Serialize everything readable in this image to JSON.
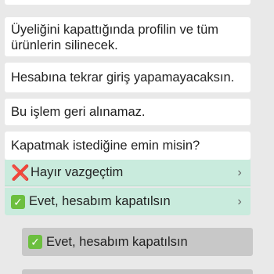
{
  "chat": {
    "bot_messages": [
      "Üyeliğini kapattığında profilin ve tüm ürünlerin silinecek.",
      "Hesabına tekrar giriş yapamayacaksın.",
      "Bu işlem geri alınamaz.",
      "Kapatmak istediğine emin misin?"
    ],
    "quick_replies": [
      {
        "icon": "cross-mark-icon",
        "label": "Hayır vazgeçtim"
      },
      {
        "icon": "check-mark-icon",
        "label": "Evet, hesabım kapatılsın"
      }
    ],
    "user_message": {
      "icon": "check-mark-icon",
      "label": "Evet, hesabım kapatılsın"
    }
  },
  "glyphs": {
    "cross": "❌",
    "check": "✓",
    "chevron": "›"
  },
  "colors": {
    "background": "#e9e9e9",
    "bot_bubble": "#ffffff",
    "quick_reply": "#c9ebdd",
    "user_bubble": "#c8c8c8",
    "cross": "#e0312b",
    "check": "#6cbf3f"
  }
}
